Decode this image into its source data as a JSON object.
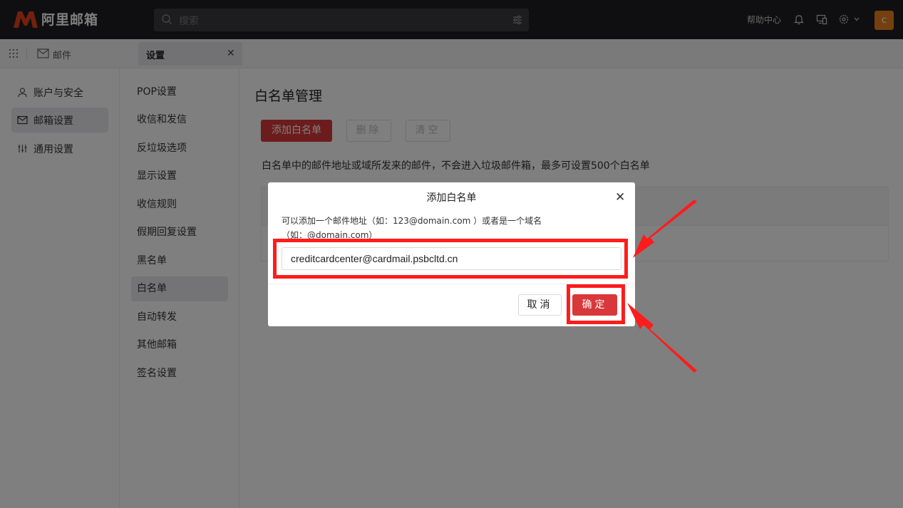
{
  "app": {
    "name": "阿里邮箱"
  },
  "topbar": {
    "search_placeholder": "搜索",
    "help_label": "帮助中心",
    "avatar_letter": "c",
    "brand_color": "#e8401f",
    "avatar_color": "#e8801f"
  },
  "tabbar": {
    "mail_label": "邮件",
    "active_tab_label": "设置"
  },
  "nav_primary": {
    "items": [
      {
        "label": "账户与安全",
        "icon": "user-icon"
      },
      {
        "label": "邮箱设置",
        "icon": "mailbox-icon",
        "active": true
      },
      {
        "label": "通用设置",
        "icon": "sliders-icon"
      }
    ]
  },
  "nav_secondary": {
    "items": [
      {
        "label": "POP设置"
      },
      {
        "label": "收信和发信"
      },
      {
        "label": "反垃圾选项"
      },
      {
        "label": "显示设置"
      },
      {
        "label": "收信规则"
      },
      {
        "label": "假期回复设置"
      },
      {
        "label": "黑名单"
      },
      {
        "label": "白名单",
        "active": true
      },
      {
        "label": "自动转发"
      },
      {
        "label": "其他邮箱"
      },
      {
        "label": "签名设置"
      }
    ]
  },
  "main": {
    "title": "白名单管理",
    "add_button": "添加白名单",
    "delete_button": "删除",
    "clear_button": "清空",
    "description": "白名单中的邮件地址或域所发来的邮件，不会进入垃圾邮件箱，最多可设置500个白名单"
  },
  "dialog": {
    "title": "添加白名单",
    "description": "可以添加一个邮件地址（如：123@domain.com ）或者是一个域名（如：@domain.com）",
    "input_value": "creditcardcenter@cardmail.psbcltd.cn",
    "cancel_button": "取消",
    "confirm_button": "确定"
  },
  "colors": {
    "accent_red": "#d9383a",
    "annotation_red": "#ff1c1c"
  }
}
